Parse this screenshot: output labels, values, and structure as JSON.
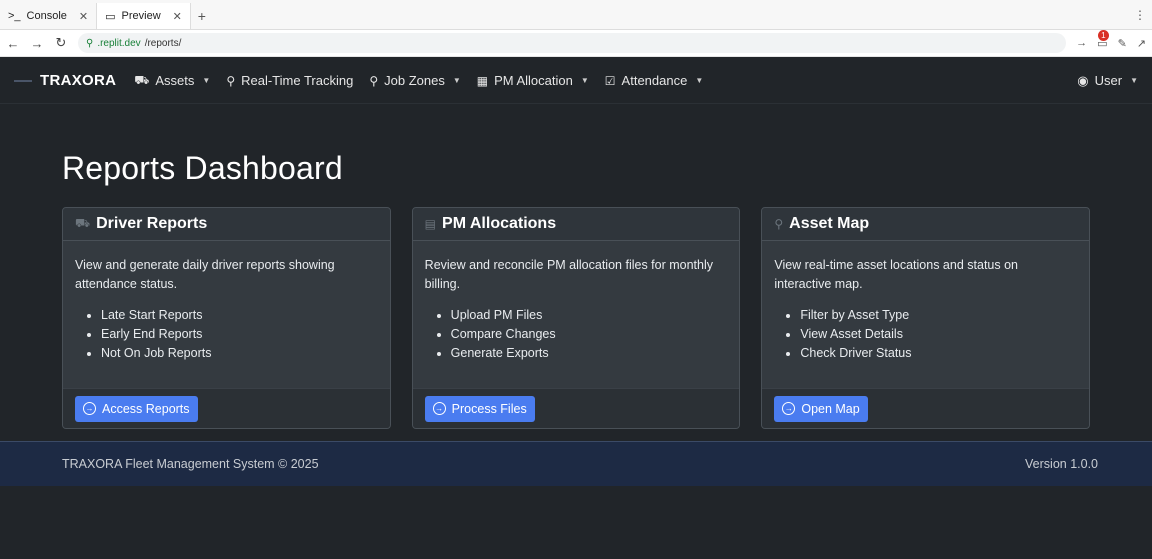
{
  "browser": {
    "tabs": [
      {
        "icon": "terminal-icon",
        "label": "Console"
      },
      {
        "icon": "monitor-icon",
        "label": "Preview"
      }
    ],
    "url_host": ".replit.dev",
    "url_path": "/reports/",
    "notification_count": "1"
  },
  "navbar": {
    "brand": "TRAXORA",
    "items": [
      {
        "label": "Assets",
        "icon": "truck-icon",
        "dropdown": true
      },
      {
        "label": "Real-Time Tracking",
        "icon": "map-pin-icon",
        "dropdown": false
      },
      {
        "label": "Job Zones",
        "icon": "location-pin-icon",
        "dropdown": true
      },
      {
        "label": "PM Allocation",
        "icon": "calculator-icon",
        "dropdown": true
      },
      {
        "label": "Attendance",
        "icon": "calendar-check-icon",
        "dropdown": true
      }
    ],
    "user_label": "User"
  },
  "page": {
    "title": "Reports Dashboard"
  },
  "cards": [
    {
      "title": "Driver Reports",
      "icon": "truck-icon",
      "description": "View and generate daily driver reports showing attendance status.",
      "items": [
        "Late Start Reports",
        "Early End Reports",
        "Not On Job Reports"
      ],
      "button": "Access Reports"
    },
    {
      "title": "PM Allocations",
      "icon": "file-invoice-icon",
      "description": "Review and reconcile PM allocation files for monthly billing.",
      "items": [
        "Upload PM Files",
        "Compare Changes",
        "Generate Exports"
      ],
      "button": "Process Files"
    },
    {
      "title": "Asset Map",
      "icon": "map-marker-icon",
      "description": "View real-time asset locations and status on interactive map.",
      "items": [
        "Filter by Asset Type",
        "View Asset Details",
        "Check Driver Status"
      ],
      "button": "Open Map"
    }
  ],
  "footer": {
    "copyright": "TRAXORA Fleet Management System © 2025",
    "version": "Version 1.0.0"
  },
  "colors": {
    "background": "#212529",
    "card": "#343a40",
    "button": "#4a7cf0",
    "footer": "#1d2a44"
  }
}
